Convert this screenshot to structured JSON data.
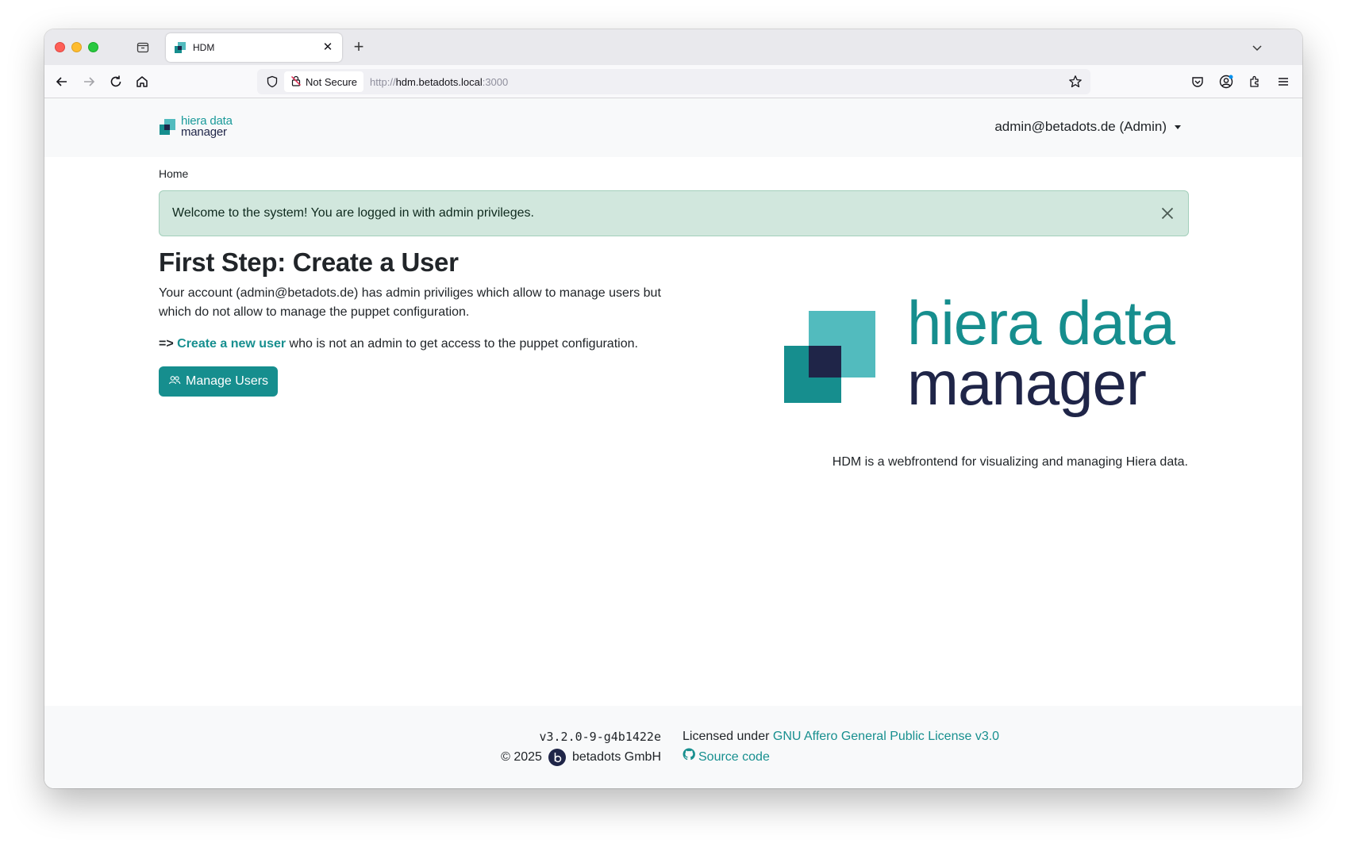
{
  "browser": {
    "tab_title": "HDM",
    "url_security": "Not Secure",
    "url_prefix": "http://",
    "url_host": "hdm.betadots.local",
    "url_port": ":3000"
  },
  "header": {
    "brand_line1": "hiera data",
    "brand_line2": "manager",
    "user_label": "admin@betadots.de (Admin)"
  },
  "breadcrumb": {
    "home": "Home"
  },
  "alert": {
    "message": "Welcome to the system! You are logged in with admin privileges."
  },
  "main": {
    "title": "First Step: Create a User",
    "description": "Your account (admin@betadots.de) has admin priviliges which allow to manage users but which do not allow to manage the puppet configuration.",
    "cta_prefix": "=>",
    "cta_link": "Create a new user",
    "cta_suffix": " who is not an admin to get access to the puppet configuration.",
    "button_label": "Manage Users"
  },
  "logo": {
    "line1": "hiera data",
    "line2": "manager"
  },
  "tagline": "HDM is a webfrontend for visualizing and managing Hiera data.",
  "footer": {
    "version": "v3.2.0-9-g4b1422e",
    "copyright": "© 2025",
    "company": "betadots GmbH",
    "license_prefix": "Licensed under",
    "license_link": "GNU Affero General Public License v3.0",
    "source_link": "Source code"
  },
  "colors": {
    "teal": "#168e8e",
    "teal_light": "#52bbbe",
    "navy": "#1f2548",
    "alert_bg": "#d1e7dd"
  }
}
